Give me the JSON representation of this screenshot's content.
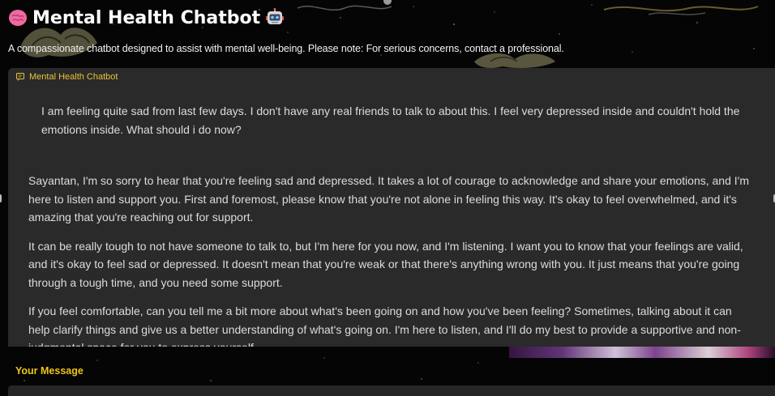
{
  "header": {
    "title": "Mental Health Chatbot",
    "leading_icon": "brain-icon",
    "trailing_icon": "robot-icon",
    "description": "A compassionate chatbot designed to assist with mental well-being. Please note: For serious concerns, contact a professional."
  },
  "chatbot": {
    "label": "Mental Health Chatbot",
    "label_icon": "chat-icon",
    "user_message": "I am feeling quite sad from last few days. I don't have any real friends to talk to about this. I feel very depressed inside and couldn't hold the emotions inside. What should i do now?",
    "bot_paragraphs": [
      "Sayantan, I'm so sorry to hear that you're feeling sad and depressed. It takes a lot of courage to acknowledge and share your emotions, and I'm here to listen and support you. First and foremost, please know that you're not alone in feeling this way. It's okay to feel overwhelmed, and it's amazing that you're reaching out for support.",
      "It can be really tough to not have someone to talk to, but I'm here for you now, and I'm listening. I want you to know that your feelings are valid, and it's okay to feel sad or depressed. It doesn't mean that you're weak or that there's anything wrong with you. It just means that you're going through a tough time, and you need some support.",
      "If you feel comfortable, can you tell me a bit more about what's been going on and how you've been feeling? Sometimes, talking about it can help clarify things and give us a better understanding of what's going on. I'm here to listen, and I'll do my best to provide a supportive and non-judgmental space for you to express yourself."
    ]
  },
  "input": {
    "label": "Your Message"
  },
  "colors": {
    "accent": "#f0c419",
    "panel": "#2a2a2a",
    "background": "#050505",
    "text": "#dcdcdc"
  }
}
